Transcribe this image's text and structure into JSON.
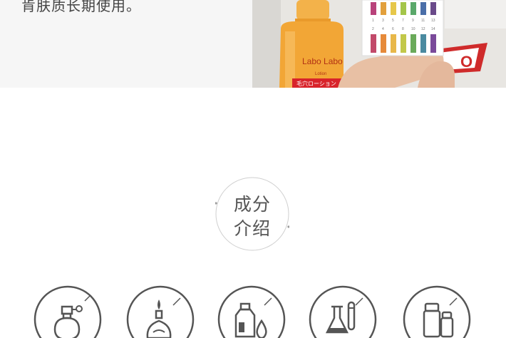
{
  "intro": {
    "text": "肯肤质长期使用。"
  },
  "photo": {
    "bottle_brand": "Labo Labo",
    "bottle_sub": "Lotion",
    "bottle_label_jp": "毛穴ローション",
    "strip_numbers_top": [
      "1",
      "3",
      "5",
      "7",
      "9",
      "11",
      "13"
    ],
    "strip_numbers_bottom": [
      "2",
      "4",
      "6",
      "8",
      "10",
      "12",
      "14"
    ]
  },
  "section": {
    "title_line1": "成分",
    "title_line2": "介绍"
  },
  "icons": [
    {
      "name": "perfume-bottle-icon"
    },
    {
      "name": "oil-lamp-icon"
    },
    {
      "name": "bottle-drop-icon"
    },
    {
      "name": "lab-flask-icon"
    },
    {
      "name": "vials-icon"
    }
  ],
  "colors": {
    "bg": "#ffffff",
    "panel_bg": "#f6f6f6",
    "icon_stroke": "#555555",
    "bottle_orange": "#f0a030",
    "label_red": "#d8232a"
  }
}
